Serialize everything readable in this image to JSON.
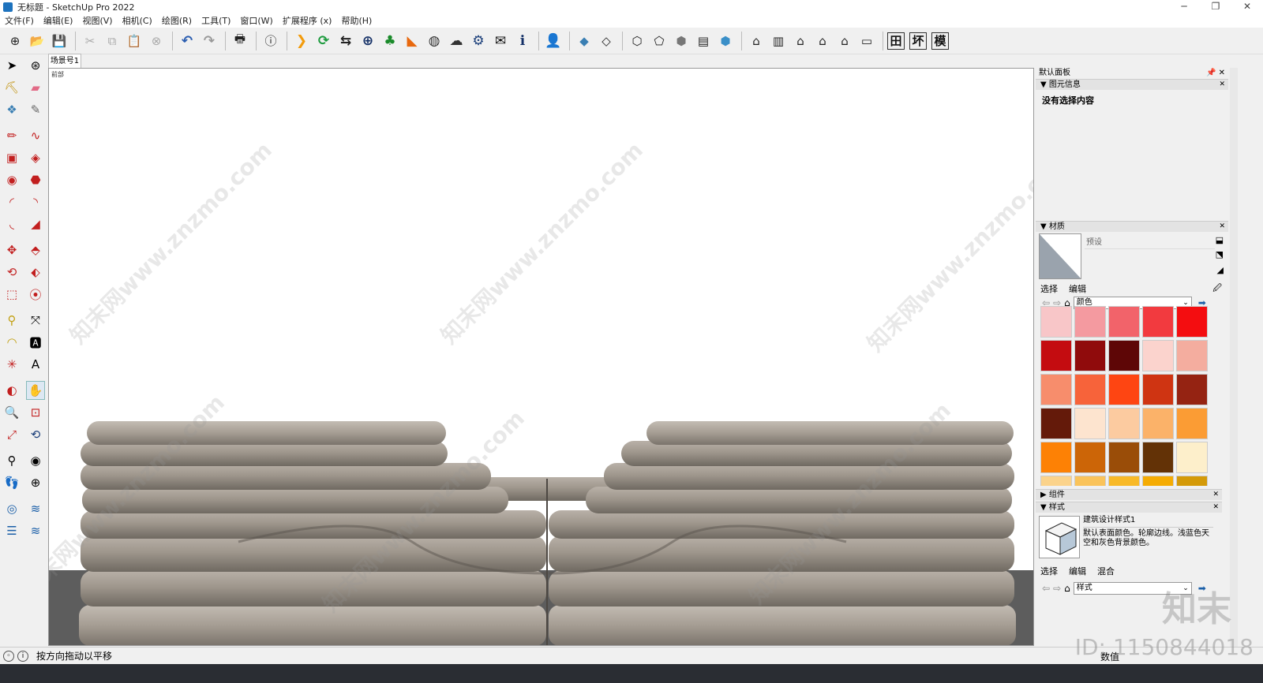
{
  "window": {
    "title": "无标题 - SketchUp Pro 2022",
    "controls": [
      "─",
      "❐",
      "✕"
    ]
  },
  "menu": [
    "文件(F)",
    "编辑(E)",
    "视图(V)",
    "相机(C)",
    "绘图(R)",
    "工具(T)",
    "窗口(W)",
    "扩展程序 (x)",
    "帮助(H)"
  ],
  "toolbar_text_buttons": [
    "田",
    "坏",
    "模"
  ],
  "scene_tab": "场景号1",
  "viewport": {
    "label": "前部",
    "watermark": "知末网www.znzmo.com"
  },
  "tray": {
    "title": "默认面板",
    "entity_info": {
      "header": "图元信息",
      "body": "没有选择内容"
    },
    "materials": {
      "header": "材质",
      "name_placeholder": "预设",
      "tabs": [
        "选择",
        "编辑"
      ],
      "collection": "颜色",
      "swatches": [
        "#f8c6c8",
        "#f49aa0",
        "#f2636a",
        "#f23a3f",
        "#f40d10",
        "#c40c10",
        "#900b0c",
        "#5e0606",
        "#fbd3cd",
        "#f4ad9f",
        "#f78d6c",
        "#f7633a",
        "#fe4512",
        "#cf3412",
        "#952312",
        "#641a0a",
        "#fde4cf",
        "#fccba0",
        "#fbb269",
        "#fb9c34",
        "#fd8105",
        "#cc6507",
        "#9a4d08",
        "#633206",
        "#fdefcb",
        "#fbd38b",
        "#fac35a",
        "#f8b927",
        "#f5ac03",
        "#d49a08"
      ]
    },
    "components": {
      "header": "组件"
    },
    "styles": {
      "header": "样式",
      "name": "建筑设计样式1",
      "description": "默认表面颜色。轮廓边线。浅蓝色天空和灰色背景颜色。",
      "tabs": [
        "选择",
        "编辑",
        "混合"
      ],
      "collection": "样式"
    }
  },
  "status": {
    "message": "按方向拖动以平移",
    "value_label": "数值"
  },
  "overlay": {
    "brand": "知末",
    "id": "ID: 1150844018"
  }
}
